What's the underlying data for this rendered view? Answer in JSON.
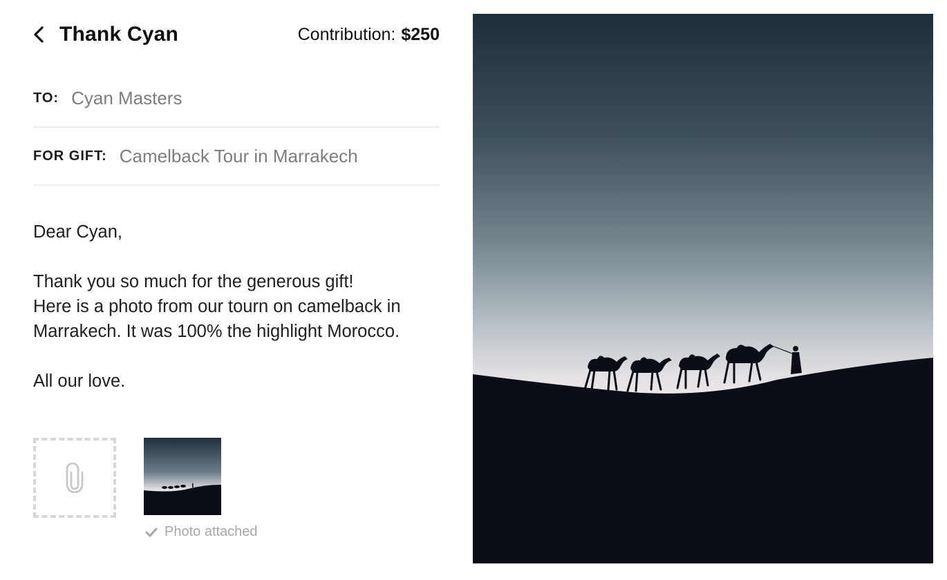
{
  "header": {
    "title": "Thank Cyan",
    "contribution_label": "Contribution:",
    "contribution_amount": "$250"
  },
  "fields": {
    "to_label": "TO:",
    "to_value": "Cyan Masters",
    "gift_label": "FOR GIFT:",
    "gift_value": "Camelback Tour in Marrakech"
  },
  "message": {
    "greeting": "Dear Cyan,",
    "line1": "Thank you so much for the generous gift!",
    "line2": "Here is a photo from our tourn on camelback in",
    "line3": "Marrakech. It was 100% the highlight Morocco.",
    "closing": "All our love."
  },
  "attachment": {
    "icon": "paperclip-icon",
    "status_icon": "checkmark-icon",
    "status_text": "Photo attached"
  },
  "colors": {
    "text": "#1a1a1a",
    "muted": "#7d7d7d",
    "divider": "#ececec",
    "sky_top": "#1f2f39",
    "sky_horizon": "#ece6e8",
    "dune": "#0b0e16"
  }
}
